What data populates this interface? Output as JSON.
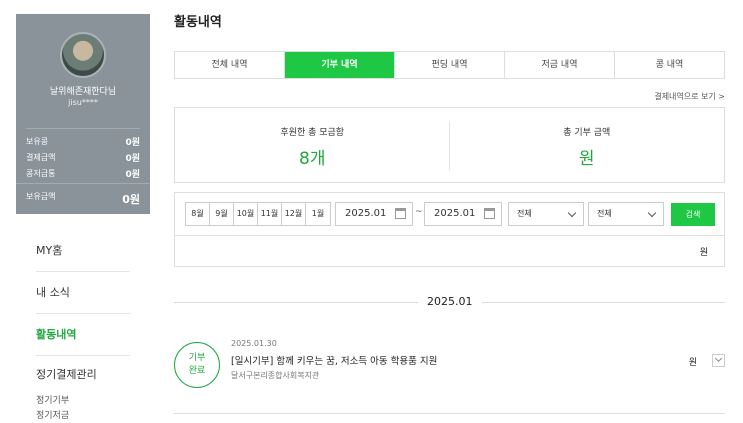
{
  "sidebar": {
    "nickname": "날위해존재한다님",
    "user_id": "jisu****",
    "stats": [
      {
        "label": "보유콩",
        "value": "0원"
      },
      {
        "label": "결제금액",
        "value": "0원"
      },
      {
        "label": "콩저금통",
        "value": "0원"
      }
    ],
    "total": {
      "label": "보유금액",
      "value": "0원"
    },
    "menu": [
      {
        "label": "MY홈"
      },
      {
        "label": "내 소식"
      },
      {
        "label": "활동내역"
      },
      {
        "label": "정기결제관리"
      }
    ],
    "sub_menu": [
      {
        "label": "정기기부"
      },
      {
        "label": "정기저금"
      }
    ]
  },
  "main": {
    "title": "활동내역",
    "tabs": [
      {
        "label": "전체 내역"
      },
      {
        "label": "기부 내역"
      },
      {
        "label": "펀딩 내역"
      },
      {
        "label": "저금 내역"
      },
      {
        "label": "콩 내역"
      }
    ],
    "active_tab": "기부 내역",
    "pay_link": "결제내역으로 보기 >",
    "summary": {
      "count_label": "후원한 총 모금함",
      "count_value": "8개",
      "amount_label": "총 기부 금액",
      "amount_value": "원"
    },
    "filter": {
      "months": [
        "8월",
        "9월",
        "10월",
        "11월",
        "12월",
        "1월"
      ],
      "date_from": "2025.01",
      "date_separator": "~",
      "date_to": "2025.01",
      "select1": "전체",
      "select2": "전체",
      "search_label": "검색"
    },
    "result_total": "원",
    "year_group": "2025.01",
    "items": [
      {
        "badge_line1": "기부",
        "badge_line2": "완료",
        "date": "2025.01.30",
        "title": "[일시기부] 함께 키우는 꿈, 저소득 아동 학용품 지원",
        "org": "달서구본리종합사회복지관",
        "amount": "원"
      }
    ]
  },
  "colors": {
    "accent": "#1ec744",
    "accent_text": "#1fa83e",
    "profile_bg": "#8a929a"
  }
}
